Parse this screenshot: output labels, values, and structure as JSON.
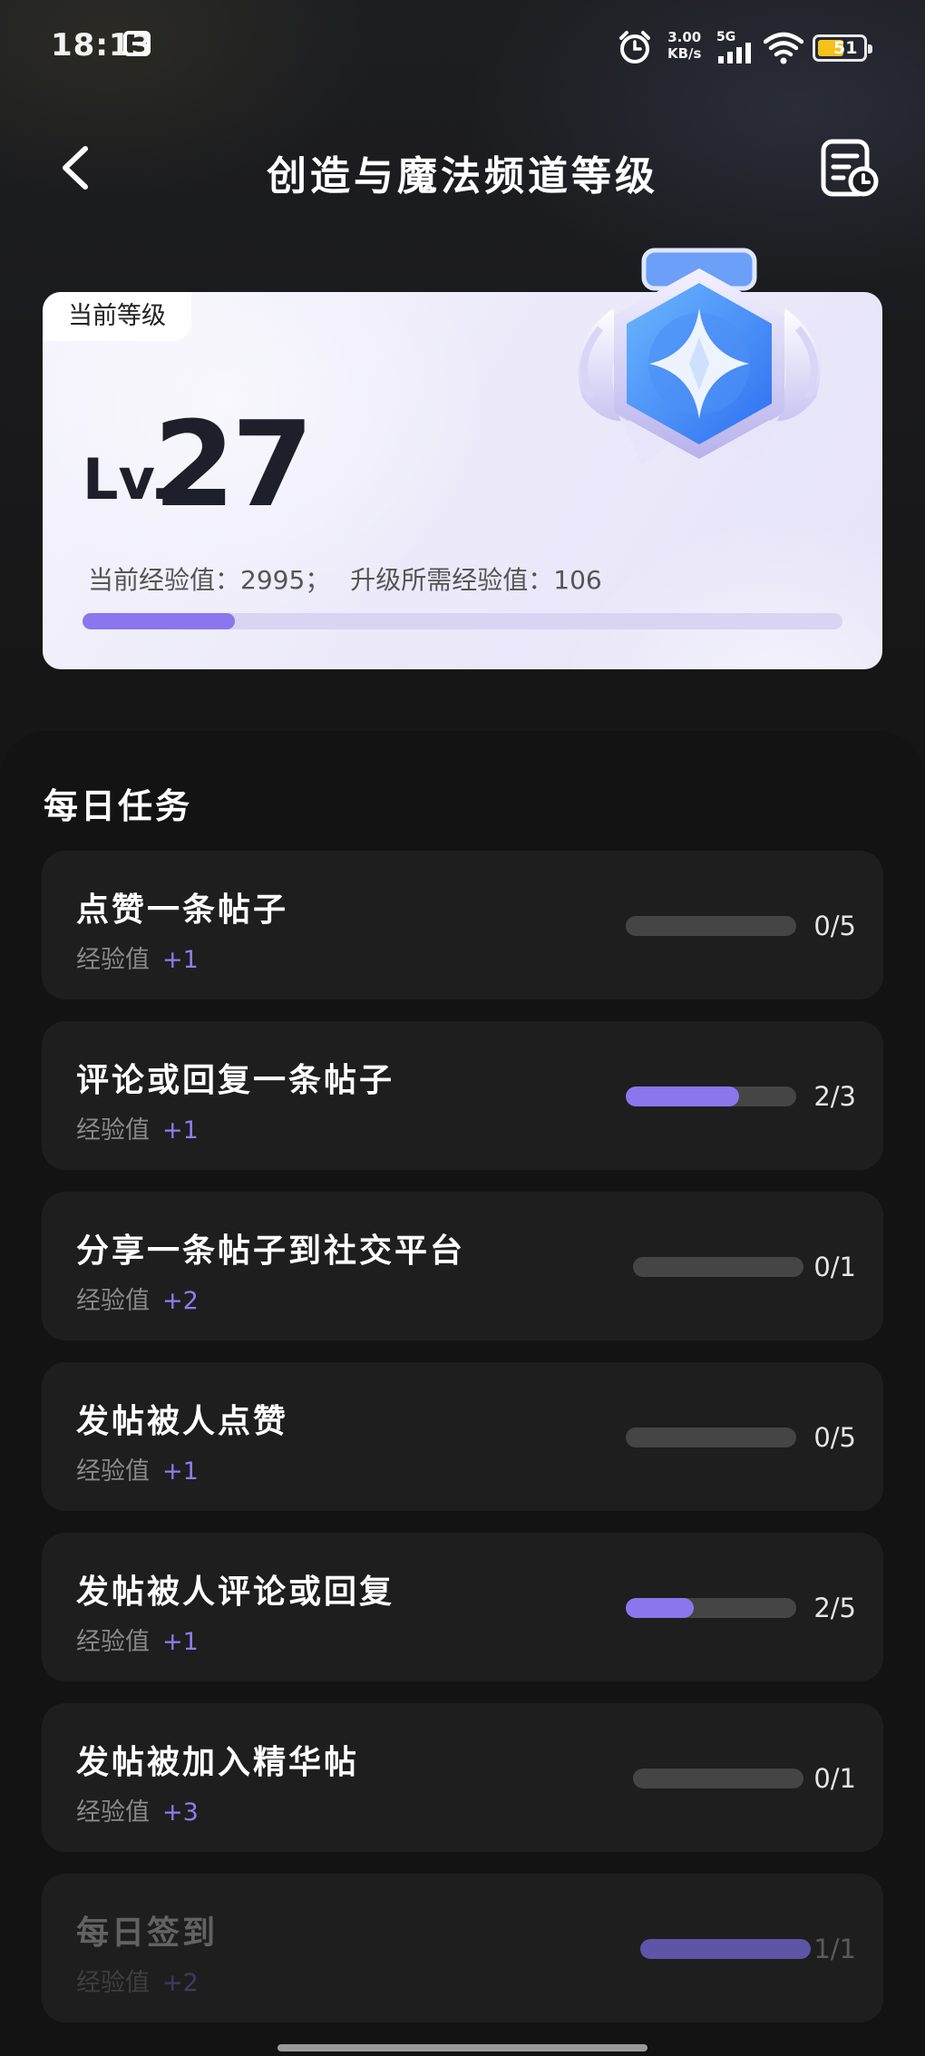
{
  "status_bar": {
    "time": "18:13",
    "speed_value": "3.00",
    "speed_unit": "KB/s",
    "network": "5G",
    "battery": "51"
  },
  "header": {
    "title": "创造与魔法频道等级"
  },
  "level_card": {
    "tag": "当前等级",
    "level_prefix": "Lv.",
    "level": "27",
    "current_exp_label": "当前经验值：2995；",
    "needed_exp_label": "升级所需经验值：106",
    "progress_fraction": 0.2
  },
  "daily_tasks": {
    "title": "每日任务",
    "exp_label": "经验值",
    "items": [
      {
        "name": "点赞一条帖子",
        "exp": "+1",
        "progress": "0/5",
        "fraction": 0.0,
        "done": false
      },
      {
        "name": "评论或回复一条帖子",
        "exp": "+1",
        "progress": "2/3",
        "fraction": 0.667,
        "done": false
      },
      {
        "name": "分享一条帖子到社交平台",
        "exp": "+2",
        "progress": "0/1",
        "fraction": 0.0,
        "done": false
      },
      {
        "name": "发帖被人点赞",
        "exp": "+1",
        "progress": "0/5",
        "fraction": 0.0,
        "done": false
      },
      {
        "name": "发帖被人评论或回复",
        "exp": "+1",
        "progress": "2/5",
        "fraction": 0.4,
        "done": false
      },
      {
        "name": "发帖被加入精华帖",
        "exp": "+3",
        "progress": "0/1",
        "fraction": 0.0,
        "done": false
      },
      {
        "name": "每日签到",
        "exp": "+2",
        "progress": "1/1",
        "fraction": 1.0,
        "done": true
      }
    ]
  },
  "colors": {
    "accent": "#8b76ee",
    "track": "#454545",
    "card": "#1e1e1e",
    "background": "#151515"
  }
}
